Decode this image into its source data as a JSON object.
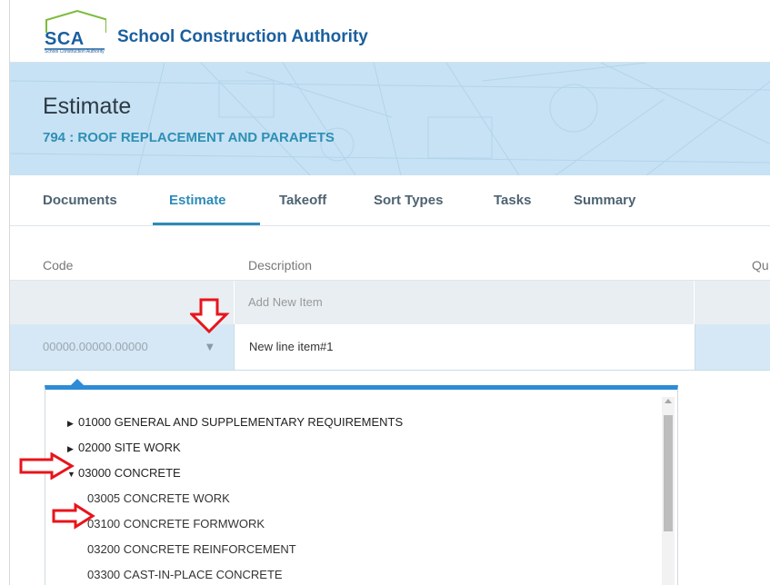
{
  "header": {
    "logo_text": "SCA",
    "logo_subtext": "School Construction Authority",
    "brand_title": "School Construction Authority"
  },
  "banner": {
    "title": "Estimate",
    "subtitle": "794 : ROOF REPLACEMENT AND PARAPETS"
  },
  "tabs": [
    {
      "label": "Documents",
      "active": false
    },
    {
      "label": "Estimate",
      "active": true
    },
    {
      "label": "Takeoff",
      "active": false
    },
    {
      "label": "Sort Types",
      "active": false
    },
    {
      "label": "Tasks",
      "active": false
    },
    {
      "label": "Summary",
      "active": false
    }
  ],
  "table": {
    "columns": [
      "Code",
      "Description",
      "Qu"
    ],
    "add_row_text": "Add New Item",
    "new_row": {
      "code": "00000.00000.00000",
      "description": "New line item#1"
    }
  },
  "dropdown": {
    "items": [
      {
        "label": "01000 GENERAL AND SUPPLEMENTARY REQUIREMENTS",
        "state": "collapsed"
      },
      {
        "label": "02000 SITE WORK",
        "state": "collapsed"
      },
      {
        "label": "03000 CONCRETE",
        "state": "expanded"
      },
      {
        "label": "03005 CONCRETE WORK",
        "state": "child"
      },
      {
        "label": "03100 CONCRETE FORMWORK",
        "state": "child"
      },
      {
        "label": "03200 CONCRETE REINFORCEMENT",
        "state": "child"
      },
      {
        "label": "03300 CAST-IN-PLACE CONCRETE",
        "state": "child"
      }
    ]
  },
  "colors": {
    "brand_blue": "#1b5f9e",
    "accent": "#2e8bb8",
    "banner_bg": "#c7e2f4",
    "selected_row": "#d6e8f5",
    "annotation_red": "#e8141b",
    "logo_green": "#7dbb3c"
  }
}
